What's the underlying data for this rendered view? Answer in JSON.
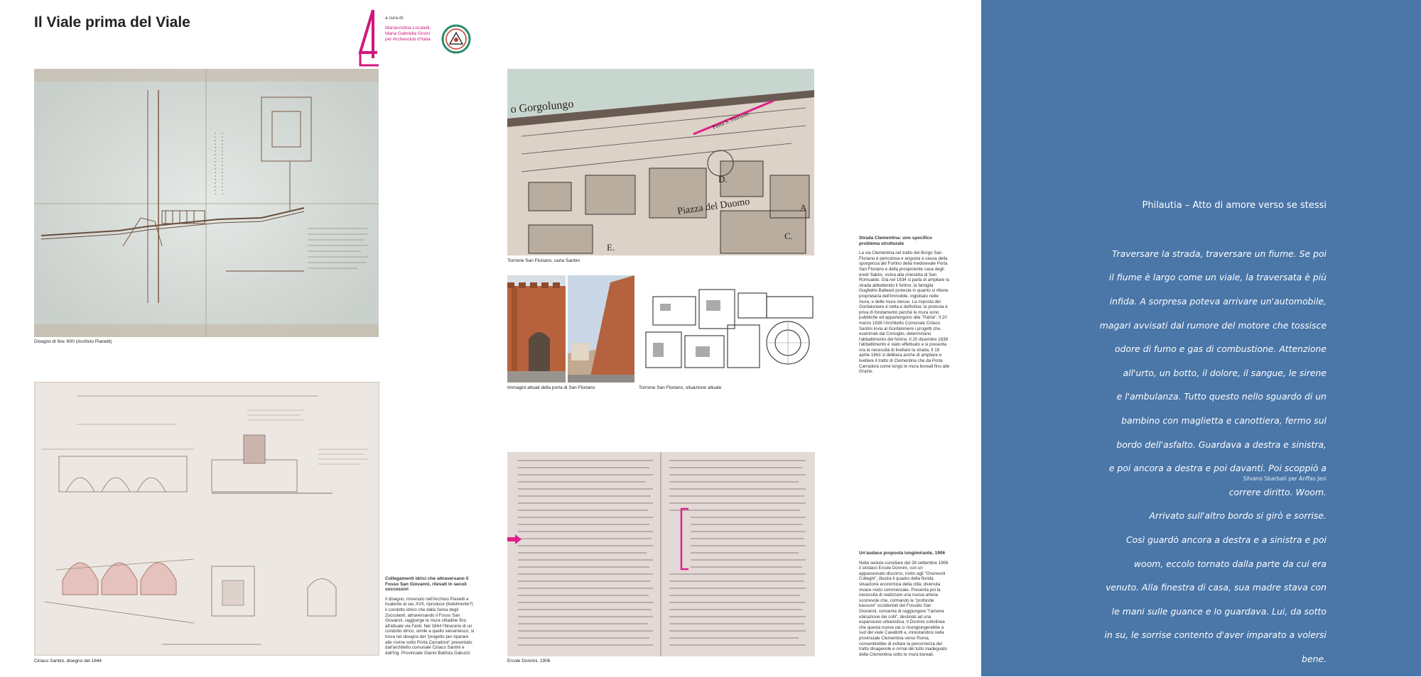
{
  "panel": {
    "title": "Il Viale prima del Viale",
    "curator_label": "a cura di:",
    "curator_names": [
      "Mariacristina Locatelli,",
      "Maria Gabriella Gironi",
      "per Archeoclub d'Italia"
    ]
  },
  "captions": {
    "map_1600": "Disegno di fine '600 (Archivio Pianetti)",
    "santini_1844": "Ciriaco Santini, disegno del 1844",
    "torrione_map": "Torrione San Floriano, carta Santini",
    "porta_photos": "Immagini attuali della porta di San Floriano",
    "torrione_plan": "Torrione San Floriano, situazione attuale",
    "letter_1906": "Ercole Donnini, 1906"
  },
  "blocks": {
    "collegamenti": {
      "title": "Collegamenti idrici che attraversano il Fosso San Giovanni, rilevati in secoli successivi",
      "body": "Il disegno, rinvenuto nell'Archivio Pianetti e risalente al sec.XVII, riproduce (fedelmente?) il condotto idrico che dalla Selva degli Zoccolanti, attraversando il Fosso San Giovanni, raggiunge le mura cittadine fino all'attuale via Fanti. Nel 1844 l'itinerario di un condotto idrico, simile a quello seicentesco, si trova nel disegno del \"progetto per riparare alle rovine sotto Porta Carradora\" presentato dall'architetto comunale Ciriaco Santini e dall'Ing. Provinciale Gianni Battista Gabuzzi"
    },
    "clementina": {
      "title": "Strada Clementina: uno specifico problema strutturale",
      "body": "La via Clementina nel tratto del Borgo San Floriano è pericolosa e angusta a causa della sporgenza del Fortino della medioevale Porta San Floriano e della prospiciente casa degli eredi Sabini, vicina alla chiesetta di San Romualdo. Già nel 1834 si parla di ampliare la strada abbattendo il fortino; la famiglia Guglielmi Balleani protesta in quanto si ritiene proprietaria dell'immobile, inglobato nelle mura, e delle mura stesse. La risposta del Gonfaloniere è netta e definitiva: la protesta è priva di fondamento perché le mura sono pubbliche ed appartengono alla \"Patria\". Il 20 marzo 1838 l'Architetto Comunale Ciriaco Santini invia al Gonfaloniere i progetti che, esaminati dal Consiglio, determinano l'abbattimento del fortino. Il 20 dicembre 1838 l'abbattimento è stato effettuato e si presenta ora la necessità di livellare la strada. Il 18 aprile 1863 si delibera anche di ampliare e livellare il tratto di Clementina che da Porta Carradora come lungo le mura boreali fino alle Grazie."
    },
    "proposta": {
      "title": "Un'audace proposta lungimirante, 1906",
      "body": "Nella seduta consiliare del 28 settembre 1906 il sindaco Ercole Donnini, con un appassionato discorso, invito agli \"Onorevoli Colleghi\", illustra il quadro della florida situazione economica della città, divenuta vivace nodo commerciale. Presenta poi la necessità di realizzare una nuova arteria scorrevole che, colmando le \"profonde bassure\" occidentali del Fossato San Giovanni, consenta di raggiungere \"l'amena ubicazione dei colli\", destinati ad una espansione urbanistica. Il Donnini sottolinea che questa nuova via ci ricongiungerebbe a sud del viale Cavallotti e, innestandosi nella provinciale Clementina verso Roma, consentirebbe di evitare la percorrenza del tratto disagevole e ormai del tutto inadeguato della Clementina sotto le mura boreali."
    }
  },
  "map_labels": {
    "gorgolungo": "o Gorgolungo",
    "piazza": "Piazza del Duomo",
    "porta": "Porta S. Floriano",
    "d": "D.",
    "e": "E.",
    "c": "C.",
    "a": "A"
  },
  "poem": {
    "title": "Philautia – Atto di amore verso se stessi",
    "lines": [
      "Traversare la strada, traversare un fiume. Se poi",
      "il fiume è largo come un viale, la traversata è più",
      "infida. A sorpresa poteva arrivare un'automobile,",
      "magari avvisati dal rumore del motore che tossisce",
      "odore di fumo e gas di combustione. Attenzione",
      "all'urto, un botto, il dolore, il sangue, le sirene",
      "e l'ambulanza. Tutto questo nello sguardo di un",
      "bambino con maglietta e canottiera, fermo sul",
      "bordo dell'asfalto. Guardava a destra e sinistra,",
      "e poi ancora a destra e poi davanti. Poi scoppiò a",
      "correre diritto. Woom.",
      "Arrivato sull'altro bordo si girò e sorrise.",
      "Così guardò ancora a destra e a sinistra e poi",
      "woom, eccolo tornato dalla parte da cui era",
      "venuto. Alla finestra di casa, sua madre stava con",
      "le mani sulle guance e lo guardava. Lui, da sotto",
      "in su, le sorrise contento d'aver imparato a volersi",
      "bene."
    ],
    "author": "Silvano Sbarbati per Anffas Jesi"
  },
  "colors": {
    "panel_blue": "#4a76a8",
    "accent_magenta": "#d0187a",
    "paper": "#dde3e0",
    "paper_warm": "#e9e4df"
  }
}
